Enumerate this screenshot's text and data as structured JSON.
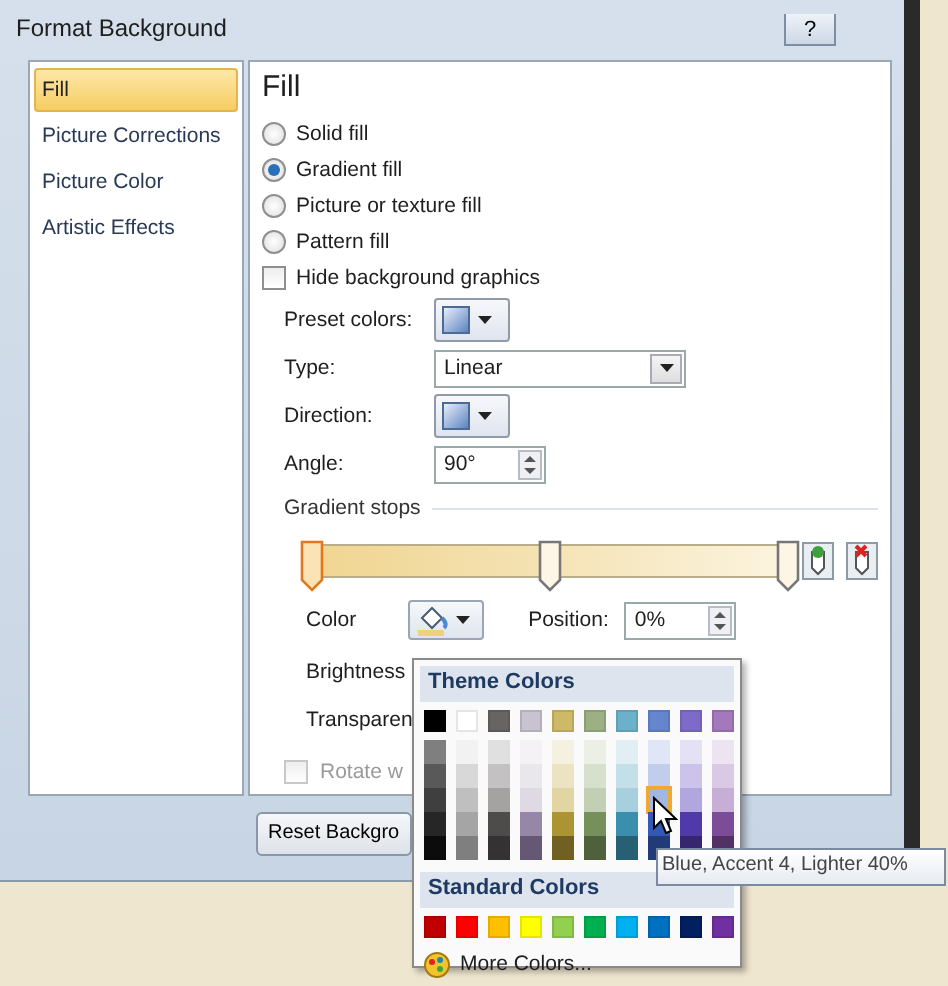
{
  "window": {
    "title": "Format Background",
    "help_button": "?"
  },
  "sidebar": {
    "items": [
      {
        "label": "Fill",
        "selected": true
      },
      {
        "label": "Picture Corrections",
        "selected": false
      },
      {
        "label": "Picture Color",
        "selected": false
      },
      {
        "label": "Artistic Effects",
        "selected": false
      }
    ]
  },
  "panel": {
    "heading": "Fill",
    "fill_options": [
      {
        "label": "Solid fill",
        "selected": false
      },
      {
        "label": "Gradient fill",
        "selected": true
      },
      {
        "label": "Picture or texture fill",
        "selected": false
      },
      {
        "label": "Pattern fill",
        "selected": false
      }
    ],
    "hide_background": {
      "label": "Hide background graphics",
      "checked": false
    },
    "preset_colors": {
      "label": "Preset colors:"
    },
    "type": {
      "label": "Type:",
      "value": "Linear"
    },
    "direction": {
      "label": "Direction:"
    },
    "angle": {
      "label": "Angle:",
      "value": "90°"
    },
    "gradient_stops": {
      "label": "Gradient stops",
      "stops": [
        {
          "level": 0,
          "selected": true
        },
        {
          "level": 0.5,
          "selected": false
        },
        {
          "level": 1,
          "selected": false
        }
      ]
    },
    "color": {
      "label": "Color"
    },
    "position": {
      "label": "Position:",
      "value": "0%"
    },
    "brightness": {
      "label": "Brightness"
    },
    "transparency": {
      "label": "Transparen"
    },
    "rotate": {
      "label": "Rotate w",
      "checked": false,
      "disabled": true
    }
  },
  "reset_button": "Reset Backgro",
  "color_menu": {
    "theme_heading": "Theme Colors",
    "theme_colors": [
      {
        "color": "#000000",
        "shades": [
          {
            "color": "#7f7f7f",
            "highlighted": false
          },
          {
            "color": "#595959",
            "highlighted": false
          },
          {
            "color": "#3f3f3f",
            "highlighted": false
          },
          {
            "color": "#262626",
            "highlighted": false
          },
          {
            "color": "#0c0c0c",
            "highlighted": false
          }
        ]
      },
      {
        "color": "#ffffff",
        "shades": [
          {
            "color": "#f2f2f2",
            "highlighted": false
          },
          {
            "color": "#d8d8d8",
            "highlighted": false
          },
          {
            "color": "#bfbfbf",
            "highlighted": false
          },
          {
            "color": "#a5a5a5",
            "highlighted": false
          },
          {
            "color": "#7f7f7f",
            "highlighted": false
          }
        ]
      },
      {
        "color": "#696464",
        "shades": [
          {
            "color": "#e1e0e0",
            "highlighted": false
          },
          {
            "color": "#c3c1c1",
            "highlighted": false
          },
          {
            "color": "#a5a2a2",
            "highlighted": false
          },
          {
            "color": "#4e4b4b",
            "highlighted": false
          },
          {
            "color": "#343232",
            "highlighted": false
          }
        ]
      },
      {
        "color": "#c9c2d1",
        "shades": [
          {
            "color": "#f4f2f5",
            "highlighted": false
          },
          {
            "color": "#e9e6ec",
            "highlighted": false
          },
          {
            "color": "#ded9e3",
            "highlighted": false
          },
          {
            "color": "#9686a8",
            "highlighted": false
          },
          {
            "color": "#645875",
            "highlighted": false
          }
        ]
      },
      {
        "color": "#ceb966",
        "shades": [
          {
            "color": "#f5f1e0",
            "highlighted": false
          },
          {
            "color": "#ebe3c1",
            "highlighted": false
          },
          {
            "color": "#e1d5a3",
            "highlighted": false
          },
          {
            "color": "#ab9533",
            "highlighted": false
          },
          {
            "color": "#725f22",
            "highlighted": false
          }
        ]
      },
      {
        "color": "#9cb084",
        "shades": [
          {
            "color": "#ebefe6",
            "highlighted": false
          },
          {
            "color": "#d7dfcd",
            "highlighted": false
          },
          {
            "color": "#c3cfb5",
            "highlighted": false
          },
          {
            "color": "#75905a",
            "highlighted": false
          },
          {
            "color": "#4e603c",
            "highlighted": false
          }
        ]
      },
      {
        "color": "#6bb1c9",
        "shades": [
          {
            "color": "#e1eff4",
            "highlighted": false
          },
          {
            "color": "#c3e0e9",
            "highlighted": false
          },
          {
            "color": "#a6d0de",
            "highlighted": false
          },
          {
            "color": "#3a8fac",
            "highlighted": false
          },
          {
            "color": "#276073",
            "highlighted": false
          }
        ]
      },
      {
        "color": "#6585cf",
        "shades": [
          {
            "color": "#e0e6f5",
            "highlighted": false
          },
          {
            "color": "#c1ceeb",
            "highlighted": false
          },
          {
            "color": "#a2b6e2",
            "highlighted": true
          },
          {
            "color": "#3259b6",
            "highlighted": false
          },
          {
            "color": "#213b79",
            "highlighted": false
          }
        ]
      },
      {
        "color": "#7e6bc9",
        "shades": [
          {
            "color": "#e5e1f4",
            "highlighted": false
          },
          {
            "color": "#cbc3e9",
            "highlighted": false
          },
          {
            "color": "#b1a6de",
            "highlighted": false
          },
          {
            "color": "#5039a8",
            "highlighted": false
          },
          {
            "color": "#352670",
            "highlighted": false
          }
        ]
      },
      {
        "color": "#a379bb",
        "shades": [
          {
            "color": "#ece4f1",
            "highlighted": false
          },
          {
            "color": "#dac9e3",
            "highlighted": false
          },
          {
            "color": "#c7aed6",
            "highlighted": false
          },
          {
            "color": "#7b4c97",
            "highlighted": false
          },
          {
            "color": "#523265",
            "highlighted": false
          }
        ]
      }
    ],
    "standard_heading": "Standard Colors",
    "standard_colors": [
      {
        "color": "#c00000"
      },
      {
        "color": "#ff0000"
      },
      {
        "color": "#ffc000"
      },
      {
        "color": "#ffff00"
      },
      {
        "color": "#92d050"
      },
      {
        "color": "#00b050"
      },
      {
        "color": "#00b0f0"
      },
      {
        "color": "#0070c0"
      },
      {
        "color": "#002060"
      },
      {
        "color": "#7030a0"
      }
    ],
    "more_colors": "More Colors..."
  },
  "tooltip": "Blue, Accent 4, Lighter 40%"
}
